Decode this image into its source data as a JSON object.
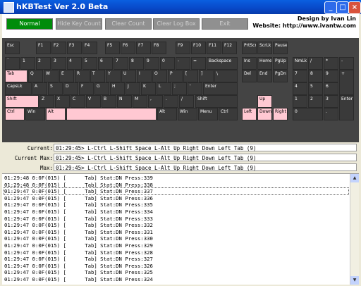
{
  "window": {
    "title": "hKBTest Ver 2.0 Beta",
    "min": "_",
    "max": "□",
    "close": "×"
  },
  "toolbar": {
    "buttons": [
      "Normal",
      "Hide Key Count",
      "Clear Count",
      "Clear Log Box",
      "Exit"
    ],
    "design_line1": "Design by Ivan Lin",
    "design_line2": "Website: http://www.ivantw.com"
  },
  "keyboard": {
    "row_fn": [
      "Esc",
      "F1",
      "F2",
      "F3",
      "F4",
      "F5",
      "F6",
      "F7",
      "F8",
      "F9",
      "F10",
      "F11",
      "F12",
      "PrtScr",
      "ScrLk",
      "Pause"
    ],
    "row_num": [
      "`",
      "1",
      "2",
      "3",
      "4",
      "5",
      "6",
      "7",
      "8",
      "9",
      "0",
      "-",
      "=",
      "Backspace",
      "Ins",
      "Home",
      "PgUp",
      "NmLk",
      "/",
      "*",
      "-"
    ],
    "row_tab": [
      "Tab",
      "Q",
      "W",
      "E",
      "R",
      "T",
      "Y",
      "U",
      "I",
      "O",
      "P",
      "[",
      "]",
      "\\",
      "Del",
      "End",
      "PgDn",
      "7",
      "8",
      "9",
      "+"
    ],
    "row_caps": [
      "CapsLk",
      "A",
      "S",
      "D",
      "F",
      "G",
      "H",
      "J",
      "K",
      "L",
      ";",
      "'",
      "Enter",
      "4",
      "5",
      "6"
    ],
    "row_shift": [
      "Shift",
      "Z",
      "X",
      "C",
      "V",
      "B",
      "N",
      "M",
      ",",
      ".",
      "/",
      "Shift",
      "Up",
      "1",
      "2",
      "3",
      "Enter"
    ],
    "row_ctrl": [
      "Ctrl",
      "Win",
      "Alt",
      "",
      "Alt",
      "Win",
      "Menu",
      "Ctrl",
      "Left",
      "Down",
      "Right",
      "0",
      "."
    ]
  },
  "stats": {
    "current_label": "Current:",
    "current_value": "01:29:45> L-Ctrl L-Shift Space L-Alt Up Right Down Left Tab (9)",
    "current_max_label": "Current Max:",
    "current_max_value": "01:29:45> L-Ctrl L-Shift Space L-Alt Up Right Down Left Tab (9)",
    "max_label": "Max:",
    "max_value": "01:29:45> L-Ctrl L-Shift Space L-Alt Up Right Down Left Tab (9)"
  },
  "log": [
    "01:29:48 0:0F(015) [      Tab] Stat:DN Press:339",
    "01:29:48 0:0F(015) [      Tab] Stat:DN Press:338",
    "01:29:47 0:0F(015) [      Tab] Stat:DN Press:337",
    "01:29:47 0:0F(015) [      Tab] Stat:DN Press:336",
    "01:29:47 0:0F(015) [      Tab] Stat:DN Press:335",
    "01:29:47 0:0F(015) [      Tab] Stat:DN Press:334",
    "01:29:47 0:0F(015) [      Tab] Stat:DN Press:333",
    "01:29:47 0:0F(015) [      Tab] Stat:DN Press:332",
    "01:29:47 0:0F(015) [      Tab] Stat:DN Press:331",
    "01:29:47 0:0F(015) [      Tab] Stat:DN Press:330",
    "01:29:47 0:0F(015) [      Tab] Stat:DN Press:329",
    "01:29:47 0:0F(015) [      Tab] Stat:DN Press:328",
    "01:29:47 0:0F(015) [      Tab] Stat:DN Press:327",
    "01:29:47 0:0F(015) [      Tab] Stat:DN Press:326",
    "01:29:47 0:0F(015) [      Tab] Stat:DN Press:325",
    "01:29:47 0:0F(015) [      Tab] Stat:DN Press:324"
  ],
  "colors": {
    "pressed": "#ffc8d2",
    "key": "#3a3a3a",
    "normal_btn": "#008c0a"
  }
}
